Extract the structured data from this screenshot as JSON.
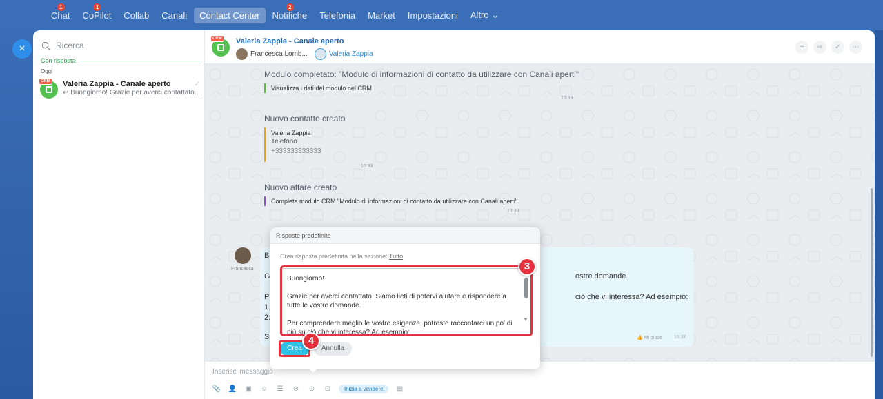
{
  "nav": {
    "items": [
      {
        "label": "Chat",
        "badge": "1"
      },
      {
        "label": "CoPilot",
        "badge": "1"
      },
      {
        "label": "Collab",
        "badge": ""
      },
      {
        "label": "Canali",
        "badge": ""
      },
      {
        "label": "Contact Center",
        "badge": "",
        "active": true
      },
      {
        "label": "Notifiche",
        "badge": "2"
      },
      {
        "label": "Telefonia",
        "badge": ""
      },
      {
        "label": "Market",
        "badge": ""
      },
      {
        "label": "Impostazioni",
        "badge": ""
      },
      {
        "label": "Altro ⌄",
        "badge": ""
      }
    ]
  },
  "close_icon": "×",
  "sidebar": {
    "search_placeholder": "Ricerca",
    "section_label": "Con risposta",
    "day_label": "Oggi",
    "chat": {
      "crm_tag": "CRM",
      "title": "Valeria Zappia - Canale aperto",
      "preview": "↩ Buongiorno! Grazie per averci contattato..."
    }
  },
  "header": {
    "crm_tag": "CRM",
    "title": "Valeria Zappia - Canale aperto",
    "user1": "Francesca Lomb...",
    "user2": "Valeria Zappia",
    "actions": [
      "+",
      "⇨",
      "✓",
      "⋯"
    ]
  },
  "messages": {
    "form": {
      "title": "Modulo completato: \"Modulo di informazioni di contatto da utilizzare con Canali aperti\"",
      "link": "Visualizza i dati del modulo nel CRM",
      "time": "15:33"
    },
    "contact": {
      "title": "Nuovo contatto creato",
      "name": "Valeria Zappia",
      "field_label": "Telefono",
      "field_value": "+333333333333",
      "time": "15:33"
    },
    "deal": {
      "title": "Nuovo affare creato",
      "desc": "Completa modulo CRM \"Modulo di informazioni di contatto da utilizzare con Canali aperti\"",
      "time": "15:33"
    },
    "bubble": {
      "author": "Francesca",
      "l1": "Bu",
      "l2": "Gr",
      "l2_right": "ostre domande.",
      "l3": "Pe",
      "l3_right": "ciò che vi interessa? Ad esempio:",
      "l4": "1.",
      "l5": "2.",
      "l6": "Si",
      "likes": "👍 Mi piace",
      "time": "15:37"
    }
  },
  "input": {
    "placeholder": "Inserisci messaggio",
    "tools": [
      "📎",
      "👤",
      "▣",
      "☺",
      "☰",
      "⊘",
      "⊙",
      "⊡"
    ],
    "sell_label": "Inizia a vendere",
    "extra_icon": "▤"
  },
  "popup": {
    "title": "Risposte predefinite",
    "desc": "Crea risposta predefinita nella sezione:",
    "section_link": "Tutto",
    "text": "Buongiorno!\n\nGrazie per averci contattato. Siamo lieti di potervi aiutare e rispondere a tutte le vostre domande.\n\nPer comprendere meglio le vostre esigenze, potreste raccontarci un po' di più su ciò che vi interessa? Ad esempio:",
    "create_label": "Crea",
    "cancel_label": "Annulla"
  },
  "annotations": {
    "step3": "3",
    "step4": "4",
    "highlight_color": "#e4333f"
  }
}
